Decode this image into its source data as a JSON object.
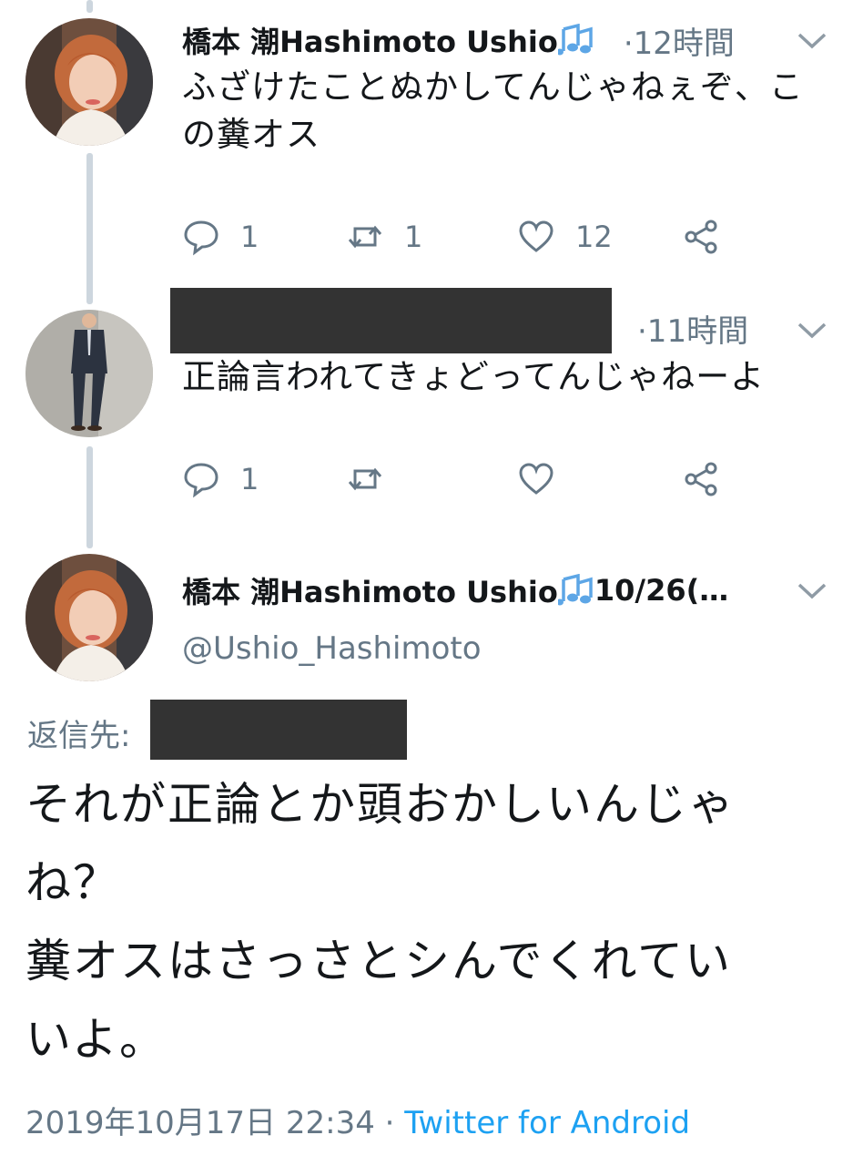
{
  "colors": {
    "text": "#14171a",
    "muted": "#657786",
    "link": "#1da1f2",
    "thread_line": "#cdd6de",
    "redaction": "#333333"
  },
  "tweets": [
    {
      "display_name": "橋本 潮Hashimoto Ushio",
      "name_icon": "music-notes-icon",
      "time": "·12時間",
      "text_lines": [
        "ふざけたことぬかしてんじゃねぇぞ、こ",
        "の糞オス"
      ],
      "reply_count": "1",
      "retweet_count": "1",
      "like_count": "12"
    },
    {
      "display_name_redacted": true,
      "time": "·11時間",
      "text_lines": [
        "正論言われてきょどってんじゃねーよ"
      ],
      "reply_count": "1",
      "retweet_count": "",
      "like_count": ""
    }
  ],
  "main_tweet": {
    "display_name": "橋本 潮Hashimoto Ushio",
    "name_icon": "music-notes-icon",
    "date_truncated": "10/26(…",
    "handle": "@Ushio_Hashimoto",
    "reply_to_label": "返信先:",
    "text_lines": [
      "それが正論とか頭おかしいんじゃ",
      "ね？",
      "糞オスはさっさとシんでくれてい",
      "いよ。"
    ],
    "timestamp": "2019年10月17日 22:34 ·",
    "source": "Twitter for Android"
  }
}
